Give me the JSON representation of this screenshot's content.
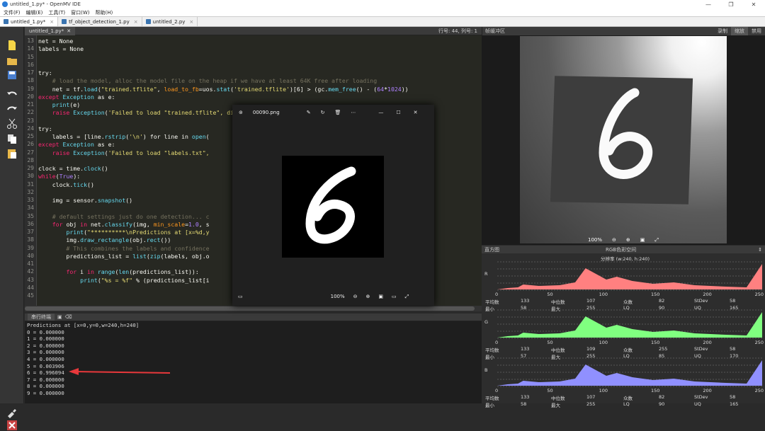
{
  "window": {
    "title": "untitled_1.py* - OpenMV IDE",
    "min": "—",
    "max": "❐",
    "close": "✕"
  },
  "menu": [
    "文件(F)",
    "编辑(E)",
    "工具(T)",
    "窗口(W)",
    "帮助(H)"
  ],
  "tabs": [
    {
      "label": "untitled_1.py*"
    },
    {
      "label": "tf_object_detection_1.py"
    },
    {
      "label": "untitled_2.py"
    }
  ],
  "editor": {
    "file": "untitled_1.py*",
    "position": "行号: 44, 列号: 1"
  },
  "code": [
    {
      "n": "13",
      "t": [
        [
          "net = None",
          ""
        ]
      ]
    },
    {
      "n": "14",
      "t": [
        [
          "labels = None",
          ""
        ]
      ]
    },
    {
      "n": "15",
      "t": []
    },
    {
      "n": "16",
      "t": []
    },
    {
      "n": "17",
      "t": [
        [
          "try",
          ""
        ],
        [
          ":",
          ""
        ]
      ]
    },
    {
      "n": "18",
      "t": [
        [
          "    # load the model, alloc the model file on the heap if we have at least 64K free after loading",
          "cm"
        ]
      ]
    },
    {
      "n": "19",
      "t": [
        [
          "    net = tf.",
          ""
        ],
        [
          "load",
          "fn"
        ],
        [
          "(",
          ""
        ],
        [
          "\"trained.tflite\"",
          "st"
        ],
        [
          ", ",
          ""
        ],
        [
          "load_to_fb",
          "pa"
        ],
        [
          "=uos.",
          ""
        ],
        [
          "stat",
          "fn"
        ],
        [
          "(",
          ""
        ],
        [
          "'trained.tflite'",
          "st"
        ],
        [
          ")[6] > (gc.",
          ""
        ],
        [
          "mem_free",
          "fn"
        ],
        [
          "() - (",
          ""
        ],
        [
          "64",
          "nm"
        ],
        [
          "*",
          ""
        ],
        [
          "1024",
          "nm"
        ],
        [
          "))",
          ""
        ]
      ]
    },
    {
      "n": "20",
      "t": [
        [
          "except ",
          "kw"
        ],
        [
          "Exception",
          "fn"
        ],
        [
          " as e:",
          ""
        ]
      ]
    },
    {
      "n": "21",
      "t": [
        [
          "    ",
          ""
        ],
        [
          "print",
          "fn"
        ],
        [
          "(e)",
          ""
        ]
      ]
    },
    {
      "n": "22",
      "t": [
        [
          "    raise ",
          "kw"
        ],
        [
          "Exception",
          "fn"
        ],
        [
          "(",
          ""
        ],
        [
          "'Failed to load \"trained.tflite\", did you copy the .tflite and labels.txt file onto the ma",
          "st"
        ]
      ]
    },
    {
      "n": "23",
      "t": []
    },
    {
      "n": "24",
      "t": [
        [
          "try",
          ""
        ],
        [
          ":",
          ""
        ]
      ]
    },
    {
      "n": "25",
      "t": [
        [
          "    labels = [line.",
          ""
        ],
        [
          "rstrip",
          "fn"
        ],
        [
          "(",
          ""
        ],
        [
          "'\\n'",
          "st"
        ],
        [
          ") for line in ",
          ""
        ],
        [
          "open",
          "fn"
        ],
        [
          "(",
          ""
        ]
      ]
    },
    {
      "n": "26",
      "t": [
        [
          "except ",
          "kw"
        ],
        [
          "Exception",
          "fn"
        ],
        [
          " as e:",
          ""
        ]
      ]
    },
    {
      "n": "27",
      "t": [
        [
          "    raise ",
          "kw"
        ],
        [
          "Exception",
          "fn"
        ],
        [
          "(",
          ""
        ],
        [
          "'Failed to load \"labels.txt\", ",
          "st"
        ],
        [
          "                                          the mass-s",
          "st"
        ]
      ]
    },
    {
      "n": "28",
      "t": []
    },
    {
      "n": "29",
      "t": [
        [
          "clock = time.",
          ""
        ],
        [
          "clock",
          "fn"
        ],
        [
          "()",
          ""
        ]
      ]
    },
    {
      "n": "30",
      "t": [
        [
          "while",
          "kw"
        ],
        [
          "(",
          ""
        ],
        [
          "True",
          "nm"
        ],
        [
          "):",
          ""
        ]
      ]
    },
    {
      "n": "31",
      "t": [
        [
          "    clock.",
          ""
        ],
        [
          "tick",
          "fn"
        ],
        [
          "()",
          ""
        ]
      ]
    },
    {
      "n": "32",
      "t": []
    },
    {
      "n": "33",
      "t": [
        [
          "    img = sensor.",
          ""
        ],
        [
          "snapshot",
          "fn"
        ],
        [
          "()",
          ""
        ]
      ]
    },
    {
      "n": "34",
      "t": []
    },
    {
      "n": "35",
      "t": [
        [
          "    # default settings just do one detection... c",
          "cm"
        ]
      ]
    },
    {
      "n": "36",
      "t": [
        [
          "    ",
          ""
        ],
        [
          "for ",
          "kw"
        ],
        [
          "obj ",
          ""
        ],
        [
          "in ",
          "kw"
        ],
        [
          "net.",
          ""
        ],
        [
          "classify",
          "fn"
        ],
        [
          "(img, ",
          ""
        ],
        [
          "min_scale",
          "pa"
        ],
        [
          "=",
          ""
        ],
        [
          "1.0",
          "nm"
        ],
        [
          ", s",
          ""
        ]
      ]
    },
    {
      "n": "37",
      "t": [
        [
          "        ",
          ""
        ],
        [
          "print",
          "fn"
        ],
        [
          "(",
          ""
        ],
        [
          "\"**********\\nPredictions at [x=%d,y",
          "st"
        ]
      ]
    },
    {
      "n": "38",
      "t": [
        [
          "        img.",
          ""
        ],
        [
          "draw_rectangle",
          "fn"
        ],
        [
          "(obj.",
          ""
        ],
        [
          "rect",
          "fn"
        ],
        [
          "())",
          ""
        ]
      ]
    },
    {
      "n": "39",
      "t": [
        [
          "        # This combines the labels and confidence",
          "cm"
        ]
      ]
    },
    {
      "n": "40",
      "t": [
        [
          "        predictions_list = ",
          ""
        ],
        [
          "list",
          "fn"
        ],
        [
          "(",
          ""
        ],
        [
          "zip",
          "fn"
        ],
        [
          "(labels, obj.o",
          ""
        ]
      ]
    },
    {
      "n": "41",
      "t": []
    },
    {
      "n": "42",
      "t": [
        [
          "        ",
          ""
        ],
        [
          "for ",
          "kw"
        ],
        [
          "i ",
          ""
        ],
        [
          "in ",
          "kw"
        ],
        [
          "range",
          "fn"
        ],
        [
          "(",
          ""
        ],
        [
          "len",
          "fn"
        ],
        [
          "(predictions_list)):",
          ""
        ]
      ]
    },
    {
      "n": "43",
      "t": [
        [
          "            ",
          ""
        ],
        [
          "print",
          "fn"
        ],
        [
          "(",
          ""
        ],
        [
          "\"%s = %f\"",
          "st"
        ],
        [
          " % (predictions_list[i",
          ""
        ]
      ]
    },
    {
      "n": "44",
      "t": []
    },
    {
      "n": "45",
      "t": []
    }
  ],
  "terminal": {
    "tab": "串行终端",
    "lines": [
      "Predictions at [x=0,y=0,w=240,h=240]",
      "0 = 0.000000",
      "1 = 0.000000",
      "2 = 0.000000",
      "3 = 0.000000",
      "4 = 0.000000",
      "5 = 0.003906",
      "6 = 0.996094",
      "7 = 0.000000",
      "8 = 0.000000",
      "9 = 0.000000"
    ]
  },
  "framebuffer": {
    "title": "帧缓冲区",
    "buttons": [
      "录制",
      "缩放",
      "禁用"
    ],
    "zoom": "100%"
  },
  "histogram": {
    "title": "直方图",
    "mode": "RGB色彩空间",
    "res": "分辨率 (w:240, h:240)",
    "channels": [
      {
        "label": "R",
        "color": "#ff8080",
        "stats": [
          [
            "平均数",
            "133",
            "中位数",
            "107",
            "众数",
            "82",
            "StDev",
            "58"
          ],
          [
            "最小",
            "58",
            "最大",
            "255",
            "LQ",
            "90",
            "UQ",
            "165"
          ]
        ]
      },
      {
        "label": "G",
        "color": "#80ff80",
        "stats": [
          [
            "平均数",
            "133",
            "中位数",
            "109",
            "众数",
            "255",
            "StDev",
            "58"
          ],
          [
            "最小",
            "57",
            "最大",
            "255",
            "LQ",
            "85",
            "UQ",
            "170"
          ]
        ]
      },
      {
        "label": "B",
        "color": "#9090ff",
        "stats": [
          [
            "平均数",
            "133",
            "中位数",
            "107",
            "众数",
            "82",
            "StDev",
            "58"
          ],
          [
            "最小",
            "58",
            "最大",
            "255",
            "LQ",
            "90",
            "UQ",
            "165"
          ]
        ]
      }
    ],
    "ticks": [
      "0",
      "50",
      "100",
      "150",
      "200",
      "250"
    ]
  },
  "viewer": {
    "filename": "00090.png",
    "zoom": "100%",
    "digit": "6"
  }
}
